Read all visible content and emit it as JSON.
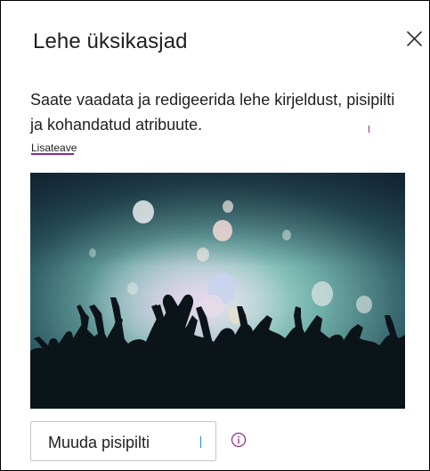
{
  "panel": {
    "title": "Lehe üksikasjad",
    "close_icon": "close-icon",
    "description": "Saate vaadata ja redigeerida lehe kirjeldust, pisipilti ja kohandatud atribuute.",
    "learn_more_label": "Lisateave",
    "thumbnail_alt": "",
    "change_thumbnail_label": "Muuda pisipilti",
    "info_icon": "info-icon"
  },
  "colors": {
    "text": "#201f1e",
    "accent_purple": "#8a2a8f",
    "border": "#c8c6c4",
    "focus_blue": "#2b88d8"
  }
}
